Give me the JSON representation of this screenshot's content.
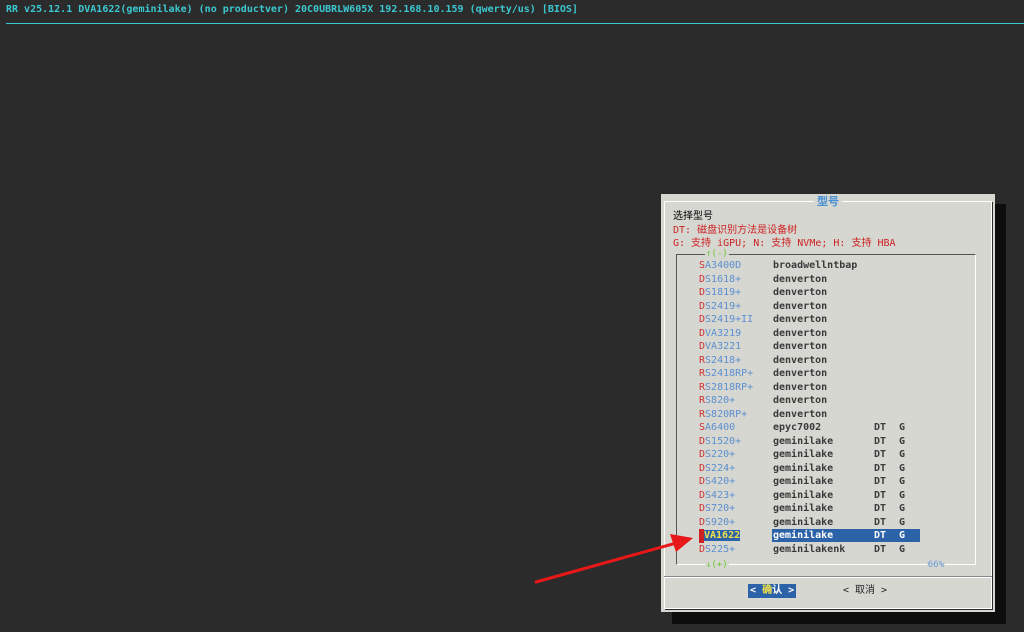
{
  "status_bar": "RR v25.12.1 DVA1622(geminilake) (no productver) 20C0UBRLW605X 192.168.10.159 (qwerty/us) [BIOS]",
  "dialog": {
    "title": "型号",
    "prompt": "选择型号",
    "note_dt": "DT: 磁盘识别方法是设备树",
    "note_flags": "G: 支持 iGPU; N: 支持 NVMe; H: 支持 HBA",
    "scroll_up": "↑(-)",
    "scroll_down": "↓(+)",
    "scroll_percent": "66%",
    "ok_prefix": "<",
    "ok_hot": "确",
    "ok_label": "认",
    "ok_suffix": ">",
    "cancel_label": "< 取消 >"
  },
  "models": [
    {
      "first": "S",
      "rest": "A3400D",
      "platform": "broadwellntbap",
      "dt": "",
      "g": ""
    },
    {
      "first": "D",
      "rest": "S1618+",
      "platform": "denverton",
      "dt": "",
      "g": ""
    },
    {
      "first": "D",
      "rest": "S1819+",
      "platform": "denverton",
      "dt": "",
      "g": ""
    },
    {
      "first": "D",
      "rest": "S2419+",
      "platform": "denverton",
      "dt": "",
      "g": ""
    },
    {
      "first": "D",
      "rest": "S2419+II",
      "platform": "denverton",
      "dt": "",
      "g": ""
    },
    {
      "first": "D",
      "rest": "VA3219",
      "platform": "denverton",
      "dt": "",
      "g": ""
    },
    {
      "first": "D",
      "rest": "VA3221",
      "platform": "denverton",
      "dt": "",
      "g": ""
    },
    {
      "first": "R",
      "rest": "S2418+",
      "platform": "denverton",
      "dt": "",
      "g": ""
    },
    {
      "first": "R",
      "rest": "S2418RP+",
      "platform": "denverton",
      "dt": "",
      "g": ""
    },
    {
      "first": "R",
      "rest": "S2818RP+",
      "platform": "denverton",
      "dt": "",
      "g": ""
    },
    {
      "first": "R",
      "rest": "S820+",
      "platform": "denverton",
      "dt": "",
      "g": ""
    },
    {
      "first": "R",
      "rest": "S820RP+",
      "platform": "denverton",
      "dt": "",
      "g": ""
    },
    {
      "first": "S",
      "rest": "A6400",
      "platform": "epyc7002",
      "dt": "DT",
      "g": "G"
    },
    {
      "first": "D",
      "rest": "S1520+",
      "platform": "geminilake",
      "dt": "DT",
      "g": "G"
    },
    {
      "first": "D",
      "rest": "S220+",
      "platform": "geminilake",
      "dt": "DT",
      "g": "G"
    },
    {
      "first": "D",
      "rest": "S224+",
      "platform": "geminilake",
      "dt": "DT",
      "g": "G"
    },
    {
      "first": "D",
      "rest": "S420+",
      "platform": "geminilake",
      "dt": "DT",
      "g": "G"
    },
    {
      "first": "D",
      "rest": "S423+",
      "platform": "geminilake",
      "dt": "DT",
      "g": "G"
    },
    {
      "first": "D",
      "rest": "S720+",
      "platform": "geminilake",
      "dt": "DT",
      "g": "G"
    },
    {
      "first": "D",
      "rest": "S920+",
      "platform": "geminilake",
      "dt": "DT",
      "g": "G"
    },
    {
      "first": "D",
      "rest": "VA1622",
      "platform": "geminilake",
      "dt": "DT",
      "g": "G",
      "selected": true
    },
    {
      "first": "D",
      "rest": "S225+",
      "platform": "geminilakenk",
      "dt": "DT",
      "g": "G"
    }
  ],
  "colors": {
    "background": "#2b2b2b",
    "status_text": "#3cc8d0",
    "dialog_bg": "#d7d7d2",
    "hotkey_red": "#cc2222",
    "model_blue": "#5a8fd0",
    "selection": "#2b62a8"
  }
}
